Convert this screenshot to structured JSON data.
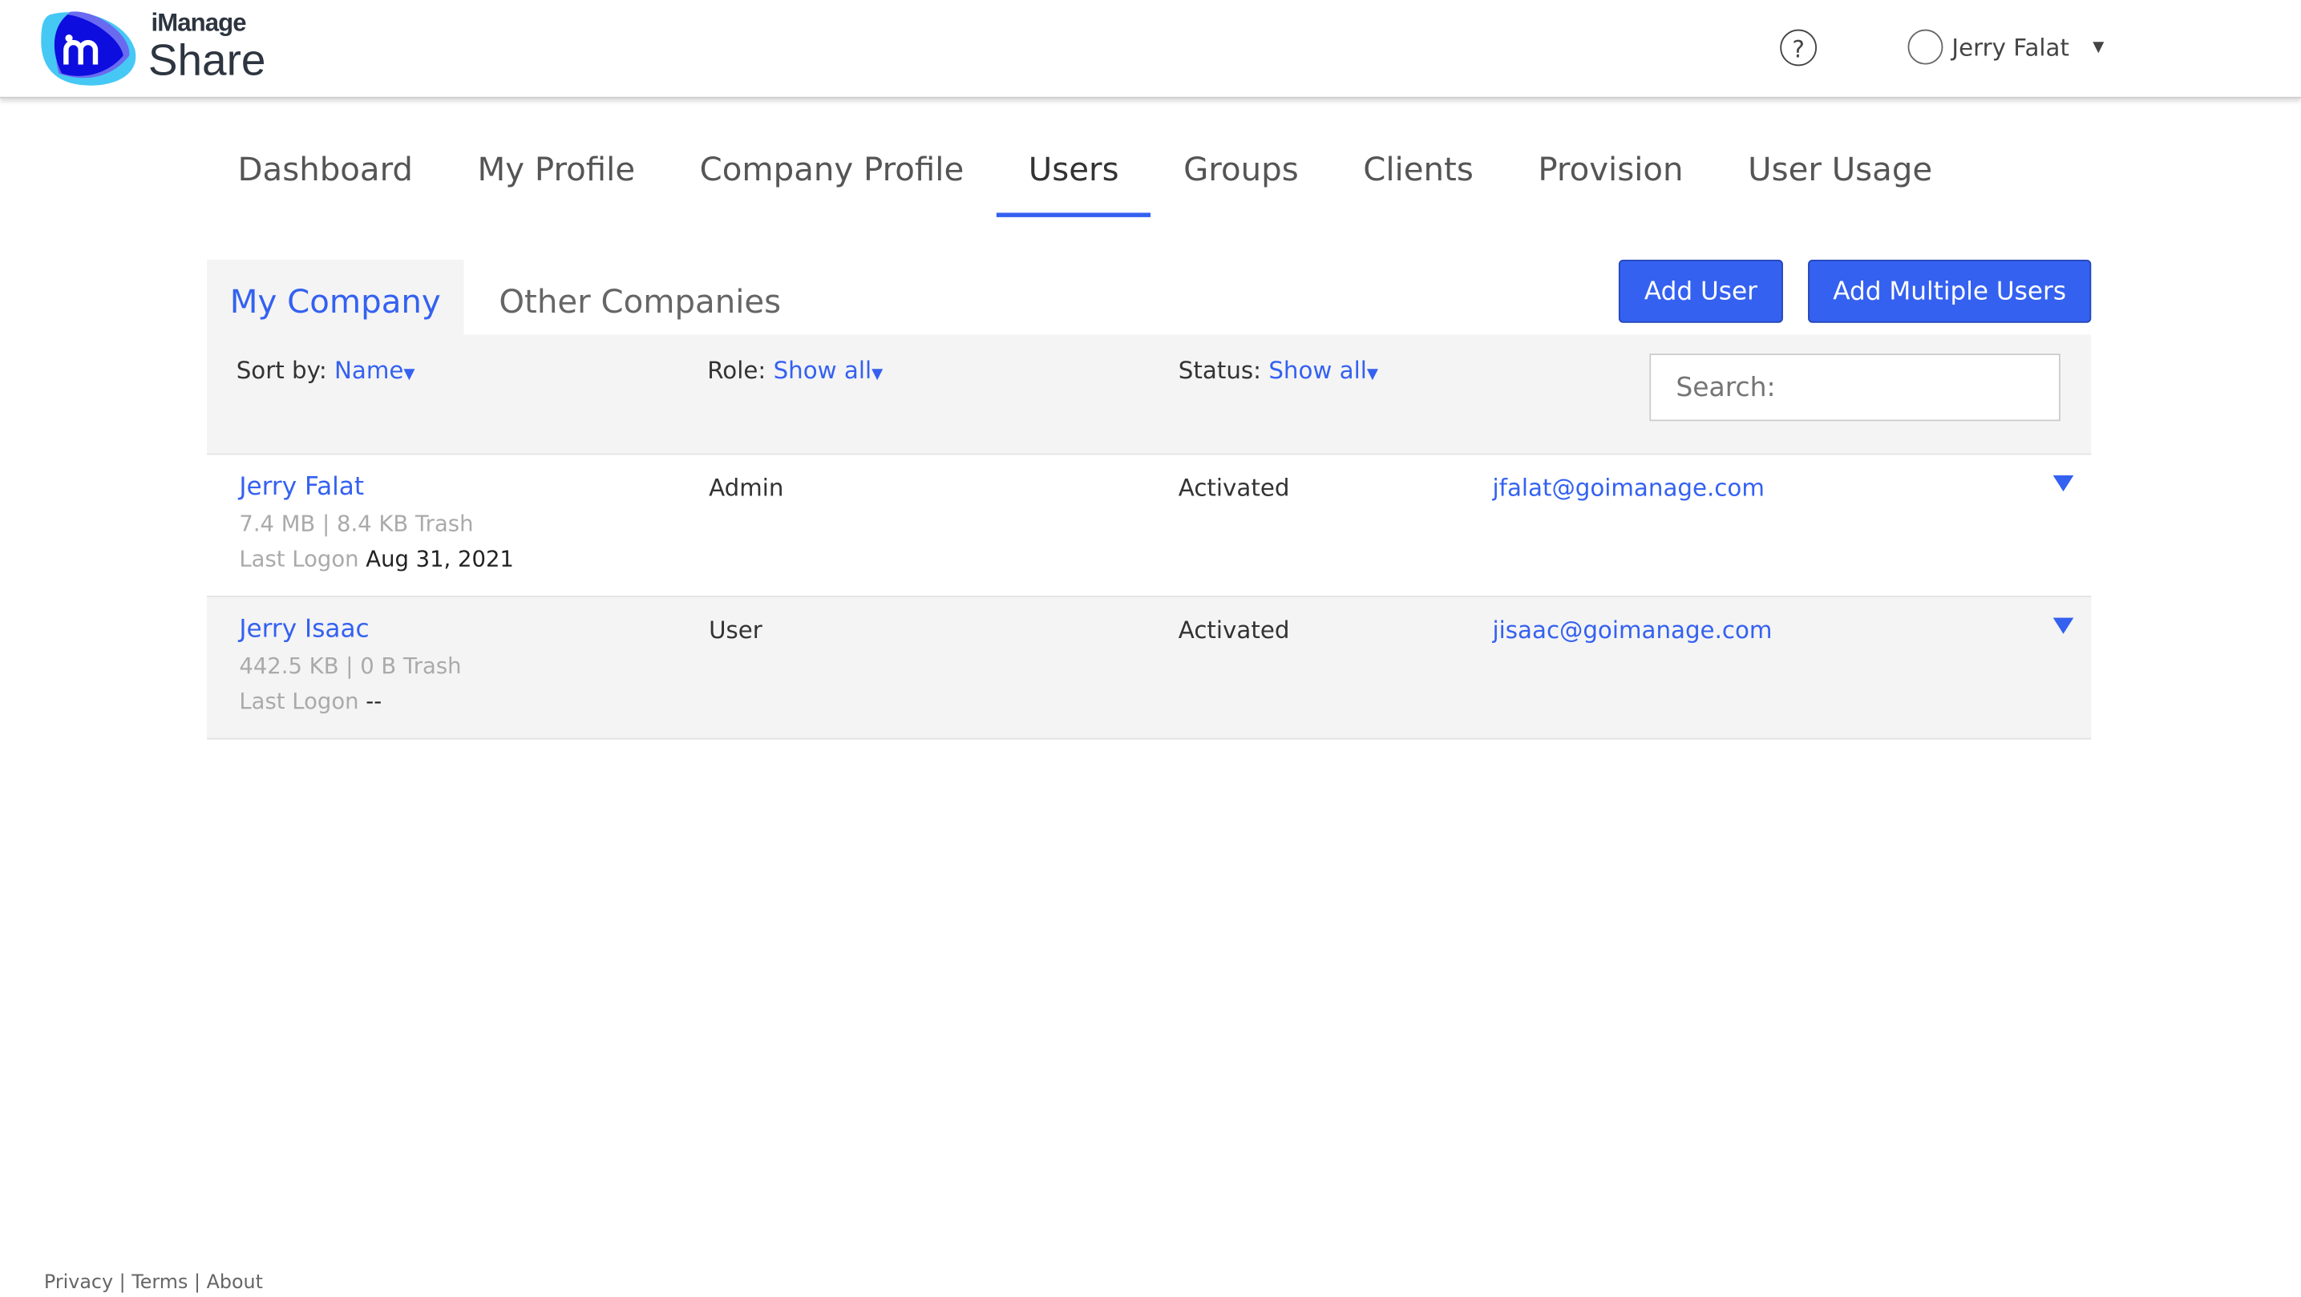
{
  "header": {
    "brand_top": "iManage",
    "brand_bottom": "Share",
    "help": "?",
    "user_name": "Jerry Falat"
  },
  "nav": [
    "Dashboard",
    "My Profile",
    "Company Profile",
    "Users",
    "Groups",
    "Clients",
    "Provision",
    "User Usage"
  ],
  "subtabs": {
    "my_company": "My Company",
    "other_companies": "Other Companies"
  },
  "buttons": {
    "add_user": "Add User",
    "add_multiple": "Add Multiple Users"
  },
  "filters": {
    "sort_label": "Sort by:",
    "sort_value": "Name",
    "role_label": "Role:",
    "role_value": "Show all",
    "status_label": "Status:",
    "status_value": "Show all",
    "search_placeholder": "Search:"
  },
  "users": [
    {
      "name": "Jerry Falat",
      "size": "7.4 MB | 8.4 KB Trash",
      "last_logon_label": "Last Logon",
      "last_logon": "Aug 31, 2021",
      "role": "Admin",
      "status": "Activated",
      "email": "jfalat@goimanage.com"
    },
    {
      "name": "Jerry Isaac",
      "size": "442.5 KB | 0 B Trash",
      "last_logon_label": "Last Logon",
      "last_logon": "--",
      "role": "User",
      "status": "Activated",
      "email": "jisaac@goimanage.com"
    }
  ],
  "footer": {
    "privacy": "Privacy",
    "terms": "Terms",
    "about": "About",
    "sep": "|"
  }
}
